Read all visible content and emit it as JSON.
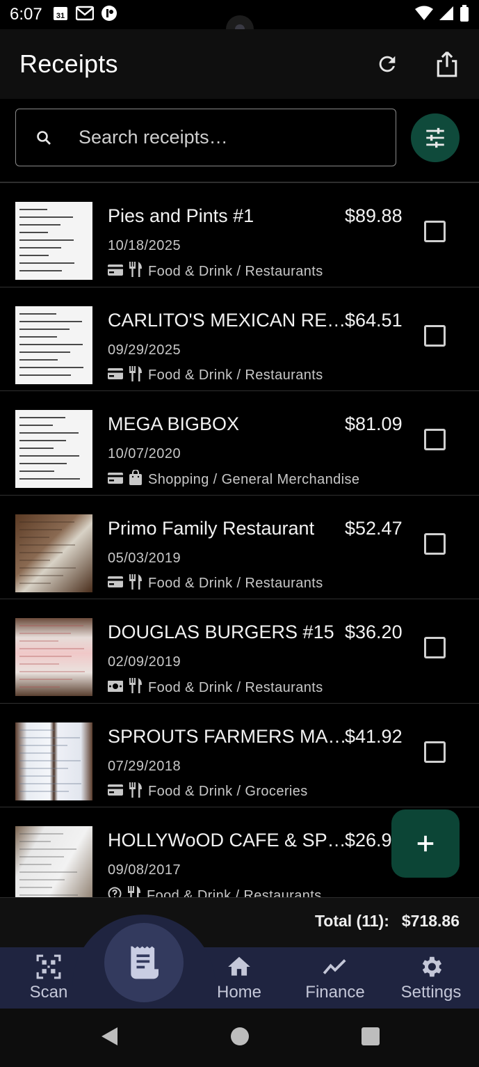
{
  "status_bar": {
    "time": "6:07",
    "calendar_day": "31"
  },
  "app_bar": {
    "title": "Receipts"
  },
  "search": {
    "placeholder": "Search receipts…"
  },
  "receipts": [
    {
      "name": "Pies and Pints #1",
      "amount": "$89.88",
      "date": "10/18/2025",
      "category": "Food & Drink / Restaurants",
      "payment_icon": "credit-card-icon",
      "category_icon": "utensils-icon",
      "thumb": "white"
    },
    {
      "name": "CARLITO'S MEXICAN RE…",
      "amount": "$64.51",
      "date": "09/29/2025",
      "category": "Food & Drink / Restaurants",
      "payment_icon": "credit-card-icon",
      "category_icon": "utensils-icon",
      "thumb": "white"
    },
    {
      "name": "MEGA BIGBOX",
      "amount": "$81.09",
      "date": "10/07/2020",
      "category": "Shopping / General Merchandise",
      "payment_icon": "credit-card-icon",
      "category_icon": "shopping-bag-icon",
      "thumb": "white"
    },
    {
      "name": "Primo Family Restaurant",
      "amount": "$52.47",
      "date": "05/03/2019",
      "category": "Food & Drink / Restaurants",
      "payment_icon": "credit-card-icon",
      "category_icon": "utensils-icon",
      "thumb": "photo-brown"
    },
    {
      "name": "DOUGLAS BURGERS #15",
      "amount": "$36.20",
      "date": "02/09/2019",
      "category": "Food & Drink / Restaurants",
      "payment_icon": "cash-icon",
      "category_icon": "utensils-icon",
      "thumb": "photo-pink"
    },
    {
      "name": "SPROUTS FARMERS MA…",
      "amount": "$41.92",
      "date": "07/29/2018",
      "category": "Food & Drink / Groceries",
      "payment_icon": "credit-card-icon",
      "category_icon": "utensils-icon",
      "thumb": "photo-blue"
    },
    {
      "name": "HOLLYWoOD CAFE & SP…",
      "amount": "$26.9",
      "date": "09/08/2017",
      "category": "Food & Drink / Restaurants",
      "payment_icon": "question-icon",
      "category_icon": "utensils-icon",
      "thumb": "photo-gray"
    }
  ],
  "total": {
    "label": "Total (11):",
    "value": "$718.86"
  },
  "nav": {
    "scan": "Scan",
    "home": "Home",
    "finance": "Finance",
    "settings": "Settings"
  },
  "colors": {
    "accent": "#0f4a3b",
    "nav_bg": "#1f2440",
    "nav_center": "#333a5e"
  }
}
